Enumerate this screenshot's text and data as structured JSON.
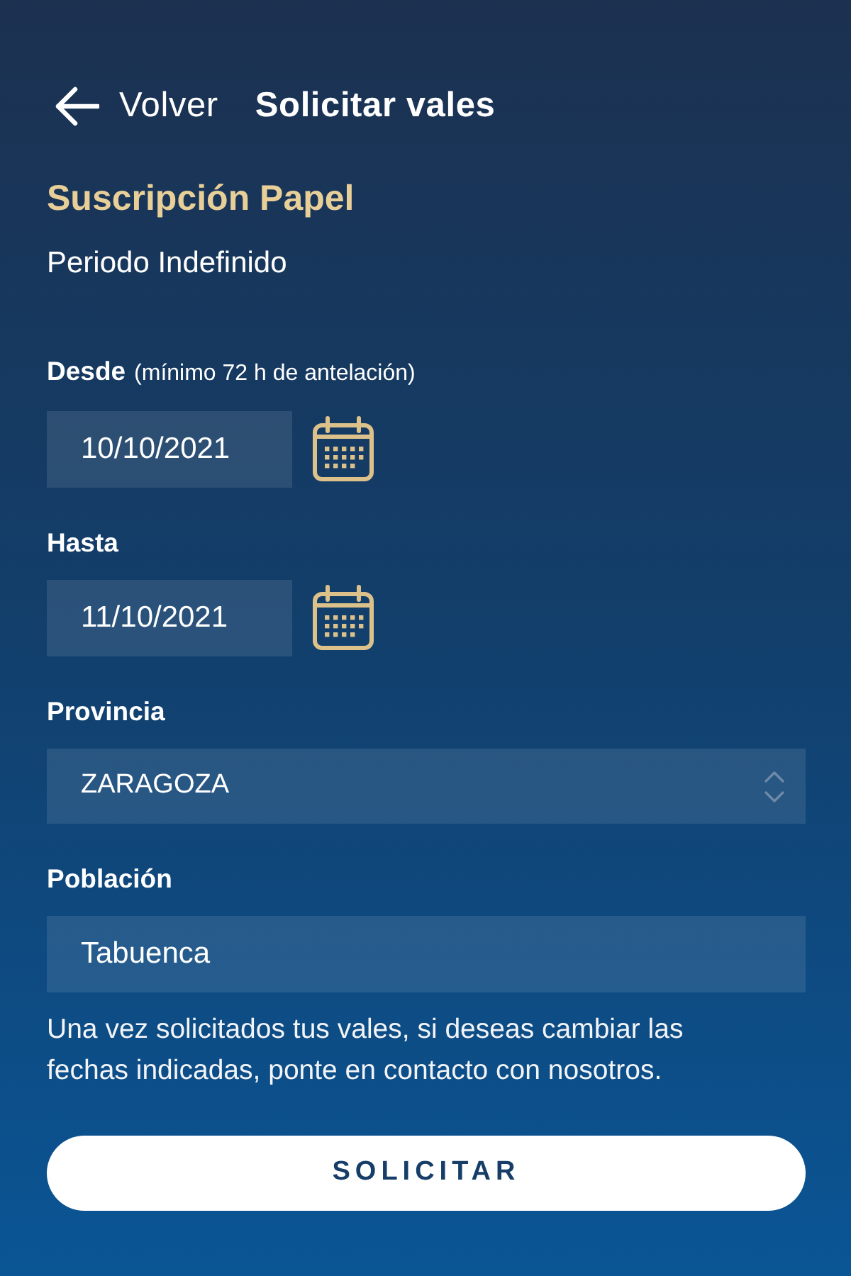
{
  "header": {
    "back_label": "Volver",
    "title": "Solicitar vales"
  },
  "subscription": {
    "name": "Suscripción Papel",
    "period": "Periodo Indefinido"
  },
  "fields": [
    {
      "kind": "date",
      "label": "Desde",
      "hint": "(mínimo 72 h de antelación)",
      "value": "10/10/2021"
    },
    {
      "kind": "date",
      "label": "Hasta",
      "value": "11/10/2021"
    },
    {
      "kind": "select",
      "label": "Provincia",
      "value": "ZARAGOZA"
    },
    {
      "kind": "text",
      "label": "Población",
      "value": "Tabuenca"
    }
  ],
  "note": "Una vez solicitados tus vales, si deseas cambiar las fechas indicadas, ponte en contacto con nosotros.",
  "submit_button": "SOLICITAR"
}
